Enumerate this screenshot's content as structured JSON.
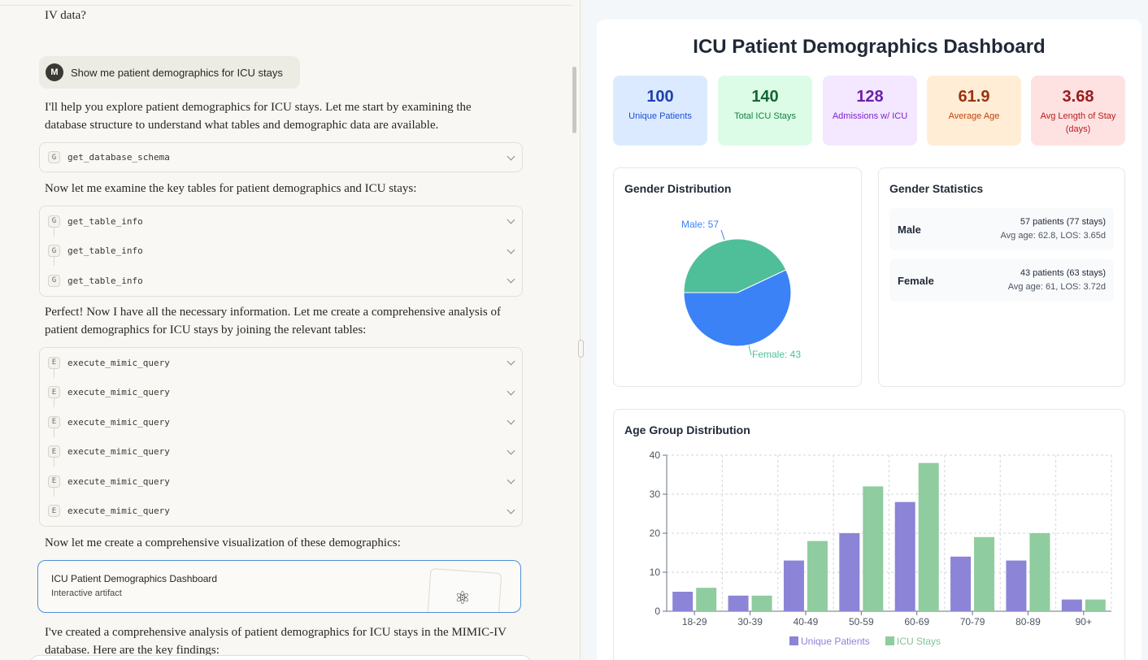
{
  "chat": {
    "top_fragment": "IV data?",
    "user_message": {
      "avatar": "M",
      "text": "Show me patient demographics for ICU stays"
    },
    "para1": "I'll help you explore patient demographics for ICU stays. Let me start by examining the database structure to understand what tables and demographic data are available.",
    "tool_schema": {
      "badge": "G",
      "name": "get_database_schema"
    },
    "para2": "Now let me examine the key tables for patient demographics and ICU stays:",
    "table_info_tools": [
      {
        "badge": "G",
        "name": "get_table_info"
      },
      {
        "badge": "G",
        "name": "get_table_info"
      },
      {
        "badge": "G",
        "name": "get_table_info"
      }
    ],
    "para3": "Perfect! Now I have all the necessary information. Let me create a comprehensive analysis of patient demographics for ICU stays by joining the relevant tables:",
    "query_tools": [
      {
        "badge": "E",
        "name": "execute_mimic_query"
      },
      {
        "badge": "E",
        "name": "execute_mimic_query"
      },
      {
        "badge": "E",
        "name": "execute_mimic_query"
      },
      {
        "badge": "E",
        "name": "execute_mimic_query"
      },
      {
        "badge": "E",
        "name": "execute_mimic_query"
      },
      {
        "badge": "E",
        "name": "execute_mimic_query"
      }
    ],
    "para4": "Now let me create a comprehensive visualization of these demographics:",
    "artifact": {
      "title": "ICU Patient Demographics Dashboard",
      "subtitle": "Interactive artifact",
      "icon": "atom-icon"
    },
    "para5": "I've created a comprehensive analysis of patient demographics for ICU stays in the MIMIC-IV database. Here are the key findings:"
  },
  "dashboard": {
    "title": "ICU Patient Demographics Dashboard",
    "stats": [
      {
        "value": "100",
        "label": "Unique Patients",
        "bg": "#dbeafe",
        "color": "#1e40af",
        "label_color": "#1d4ed8"
      },
      {
        "value": "140",
        "label": "Total ICU Stays",
        "bg": "#dcfce7",
        "color": "#166534",
        "label_color": "#15803d"
      },
      {
        "value": "128",
        "label": "Admissions w/ ICU",
        "bg": "#f3e8ff",
        "color": "#6b21a8",
        "label_color": "#7e22ce"
      },
      {
        "value": "61.9",
        "label": "Average Age",
        "bg": "#ffedd5",
        "color": "#9a3412",
        "label_color": "#c2410c"
      },
      {
        "value": "3.68",
        "label": "Avg Length of Stay (days)",
        "bg": "#fee2e2",
        "color": "#991b1b",
        "label_color": "#b91c1c"
      }
    ],
    "gender_chart_title": "Gender Distribution",
    "gender_stats_title": "Gender Statistics",
    "gender_stats": [
      {
        "name": "Male",
        "line1": "57 patients (77 stays)",
        "line2": "Avg age: 62.8, LOS: 3.65d"
      },
      {
        "name": "Female",
        "line1": "43 patients (63 stays)",
        "line2": "Avg age: 61, LOS: 3.72d"
      }
    ],
    "age_chart_title": "Age Group Distribution"
  },
  "chart_data": [
    {
      "type": "pie",
      "title": "Gender Distribution",
      "slices": [
        {
          "label": "Male: 57",
          "name": "Male",
          "value": 57,
          "color": "#3b82f6"
        },
        {
          "label": "Female: 43",
          "name": "Female",
          "value": 43,
          "color": "#4fbf9a"
        }
      ]
    },
    {
      "type": "bar",
      "title": "Age Group Distribution",
      "categories": [
        "18-29",
        "30-39",
        "40-49",
        "50-59",
        "60-69",
        "70-79",
        "80-89",
        "90+"
      ],
      "series": [
        {
          "name": "Unique Patients",
          "values": [
            5,
            4,
            13,
            20,
            28,
            14,
            13,
            3
          ],
          "color": "#8b84d7"
        },
        {
          "name": "ICU Stays",
          "values": [
            6,
            4,
            18,
            32,
            38,
            19,
            20,
            3
          ],
          "color": "#8fcc9f"
        }
      ],
      "ylim": [
        0,
        40
      ],
      "yticks": [
        0,
        10,
        20,
        30,
        40
      ],
      "grid": true,
      "legend": "bottom"
    }
  ]
}
